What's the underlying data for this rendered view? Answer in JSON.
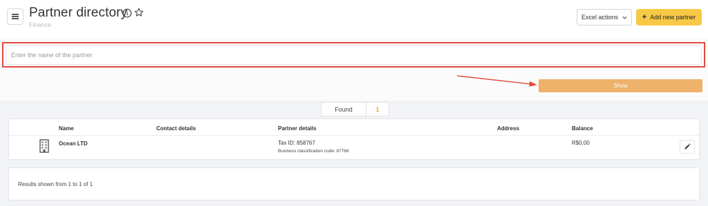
{
  "header": {
    "title": "Partner directory",
    "subtitle": "Finance",
    "excel_actions_label": "Excel actions",
    "add_partner_label": "Add new partner",
    "add_partner_icon": "+"
  },
  "search": {
    "placeholder": "Enter the name of the partner",
    "value": "",
    "show_label": "Show"
  },
  "found": {
    "label": "Found",
    "count": "1"
  },
  "table": {
    "columns": [
      "Name",
      "Contact details",
      "Partner details",
      "Address",
      "Balance"
    ],
    "rows": [
      {
        "icon": "building-icon",
        "name": "Ocean LTD",
        "contact_details": "",
        "tax_id": "Tax ID: 858767",
        "classification": "Business classification code: 87766",
        "address": "",
        "balance": "R$0,00"
      }
    ]
  },
  "footer": {
    "results_text": "Results shown from 1 to 1 of 1"
  },
  "colors": {
    "accent_yellow": "#f7c946",
    "show_button": "#eeb26b",
    "highlight_red": "#e04b3a",
    "found_count": "#e0a640"
  }
}
